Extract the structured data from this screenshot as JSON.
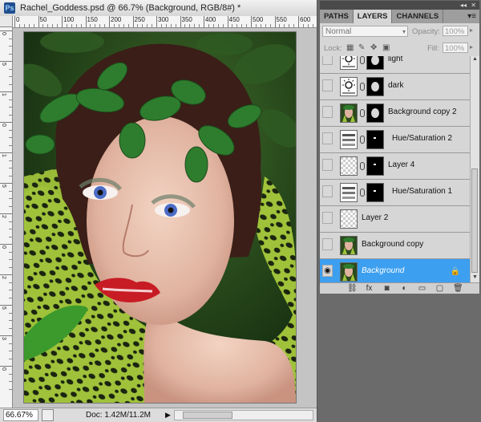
{
  "app": "Photoshop",
  "document": {
    "title": "Rachel_Goddess.psd @ 66.7% (Background, RGB/8#) *",
    "ruler_h_labels": [
      "0",
      "50",
      "100",
      "150",
      "200",
      "250",
      "300",
      "350",
      "400",
      "450",
      "500",
      "550",
      "600"
    ],
    "ruler_v_labels": [
      "0",
      "5",
      "1",
      "0",
      "1",
      "5",
      "2",
      "0",
      "2",
      "5",
      "3",
      "0"
    ],
    "status": {
      "zoom": "66.67%",
      "doc_size": "Doc: 1.42M/11.2M",
      "arrow": "▶"
    }
  },
  "layers_panel": {
    "tabs": [
      {
        "label": "PATHS",
        "active": false
      },
      {
        "label": "LAYERS",
        "active": true
      },
      {
        "label": "CHANNELS",
        "active": false
      }
    ],
    "menu_icon": "▾≡",
    "collapse_icon": "◂◂",
    "close_icon": "✕",
    "blend_mode": "Normal",
    "opacity_label": "Opacity:",
    "opacity_value": "100%",
    "lock_label": "Lock:",
    "fill_label": "Fill:",
    "fill_value": "100%",
    "layers": [
      {
        "name": "light",
        "type": "adjustment-curves",
        "visible": false
      },
      {
        "name": "dark",
        "type": "adjustment-curves",
        "visible": false
      },
      {
        "name": "Background copy 2",
        "type": "image-mask",
        "visible": false
      },
      {
        "name": "Hue/Saturation 2",
        "type": "adjustment-huesat",
        "visible": false
      },
      {
        "name": "Layer 4",
        "type": "blank-mask",
        "visible": false
      },
      {
        "name": "Hue/Saturation 1",
        "type": "adjustment-huesat",
        "visible": false
      },
      {
        "name": "Layer 2",
        "type": "transparent",
        "visible": false
      },
      {
        "name": "Background copy",
        "type": "image",
        "visible": false
      },
      {
        "name": "Background",
        "type": "image",
        "visible": true,
        "selected": true,
        "locked": true
      }
    ],
    "bottom_icons": [
      "link-icon",
      "fx-icon",
      "mask-icon",
      "adjustment-icon",
      "group-icon",
      "new-layer-icon",
      "trash-icon"
    ],
    "bottom_glyphs": [
      "⛓",
      "fx",
      "◙",
      "◐",
      "▭",
      "▢",
      "🗑"
    ]
  },
  "colors": {
    "selection": "#3c9ff0",
    "panel_bg": "#d6d6d6",
    "workspace_bg": "#6b6b6b"
  }
}
